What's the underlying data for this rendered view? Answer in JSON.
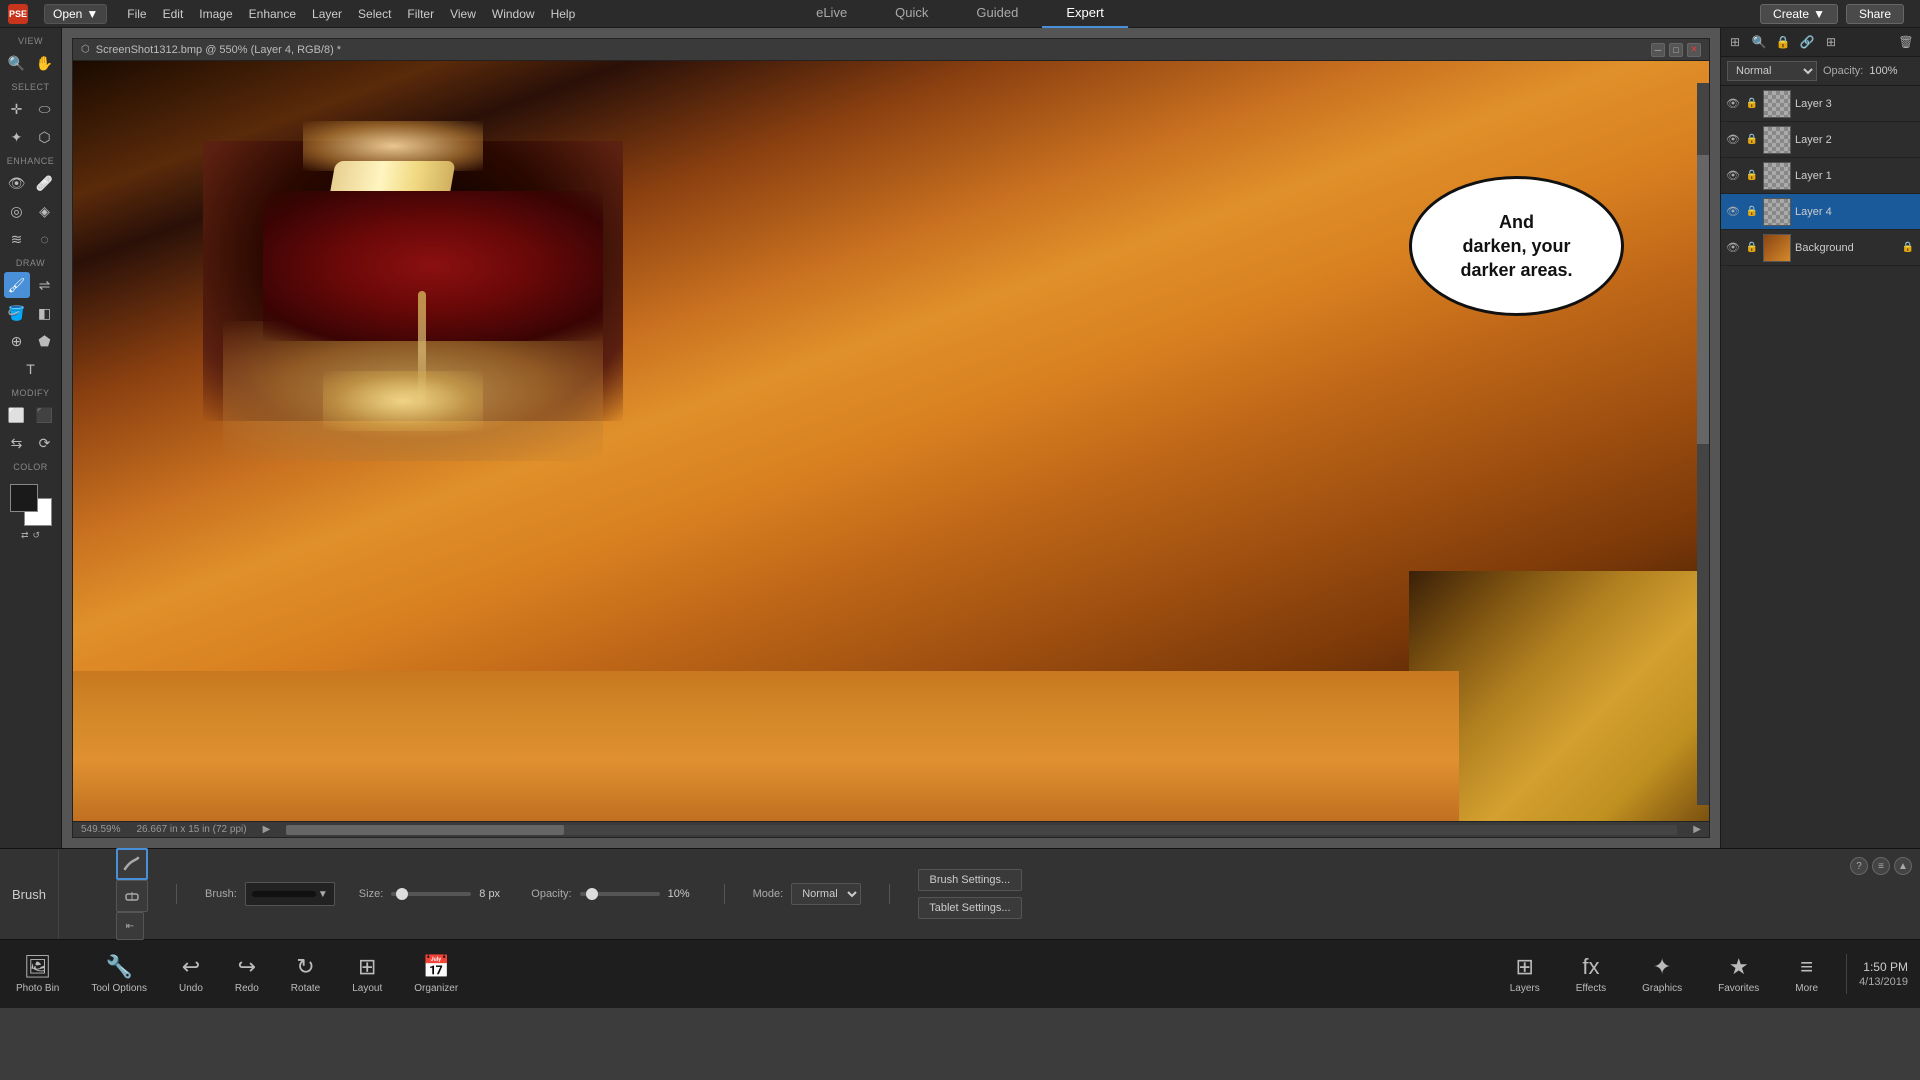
{
  "app": {
    "title": "Photoshop Elements",
    "logo_text": "PSE"
  },
  "menu": {
    "items": [
      "File",
      "Edit",
      "Image",
      "Enhance",
      "Layer",
      "Select",
      "Filter",
      "View",
      "Window",
      "Help"
    ]
  },
  "open_button": {
    "label": "Open",
    "arrow": "▼"
  },
  "mode_tabs": {
    "items": [
      "eLive",
      "Quick",
      "Guided",
      "Expert"
    ],
    "active": "Expert"
  },
  "header_right": {
    "create_label": "Create",
    "share_label": "Share"
  },
  "canvas": {
    "title": "ScreenShot1312.bmp @ 550% (Layer 4, RGB/8) *",
    "zoom": "549.59%",
    "dimensions": "26.667 in x 15 in (72 ppi)",
    "speech_bubble_text": "And\ndarken, your\ndarker areas."
  },
  "right_panel": {
    "blend_mode": "Normal",
    "opacity_label": "Opacity:",
    "opacity_value": "100%",
    "layers": [
      {
        "name": "Layer 3",
        "visible": true,
        "locked": false,
        "thumb_type": "checker",
        "selected": false
      },
      {
        "name": "Layer 2",
        "visible": true,
        "locked": false,
        "thumb_type": "checker",
        "selected": false
      },
      {
        "name": "Layer 1",
        "visible": true,
        "locked": false,
        "thumb_type": "checker",
        "selected": false
      },
      {
        "name": "Layer 4",
        "visible": true,
        "locked": false,
        "thumb_type": "checker",
        "selected": true
      },
      {
        "name": "Background",
        "visible": true,
        "locked": true,
        "thumb_type": "image",
        "selected": false
      }
    ]
  },
  "toolbar": {
    "view_label": "VIEW",
    "select_label": "SELECT",
    "enhance_label": "ENHANCE",
    "draw_label": "DRAW",
    "modify_label": "MODIFY",
    "color_label": "COLOR"
  },
  "brush_options": {
    "tool_name": "Brush",
    "brush_label": "Brush:",
    "size_label": "Size:",
    "size_value": "8 px",
    "opacity_label": "Opacity:",
    "opacity_value": "10%",
    "mode_label": "Mode:",
    "mode_value": "Normal",
    "brush_settings_btn": "Brush Settings...",
    "tablet_settings_btn": "Tablet Settings..."
  },
  "bottom_taskbar": {
    "items": [
      {
        "icon": "🖼",
        "label": "Photo Bin"
      },
      {
        "icon": "🔧",
        "label": "Tool Options"
      },
      {
        "icon": "↩",
        "label": "Undo"
      },
      {
        "icon": "↪",
        "label": "Redo"
      },
      {
        "icon": "↻",
        "label": "Rotate"
      },
      {
        "icon": "⊞",
        "label": "Layout"
      },
      {
        "icon": "📅",
        "label": "Organizer"
      }
    ],
    "right_items": [
      {
        "icon": "⊞",
        "label": "Layers"
      },
      {
        "icon": "fx",
        "label": "Effects"
      },
      {
        "icon": "+",
        "label": "Graphics"
      },
      {
        "icon": "★",
        "label": "Favorites"
      },
      {
        "icon": "≡",
        "label": "More"
      }
    ]
  },
  "status_bar": {
    "time": "1:50 PM",
    "date": "4/13/2019"
  }
}
